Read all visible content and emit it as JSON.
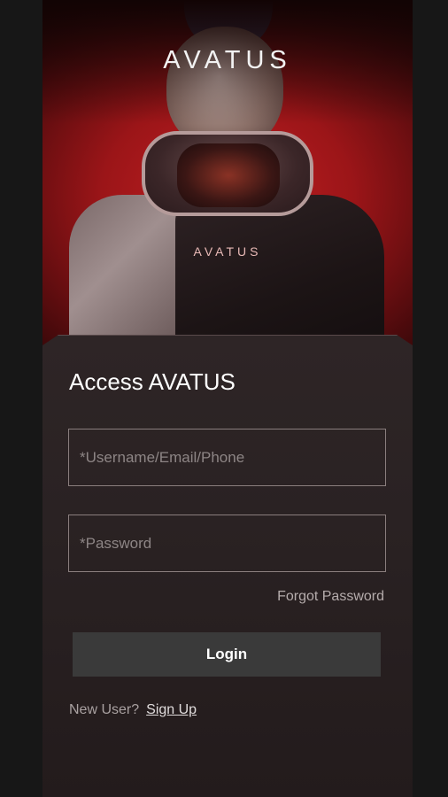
{
  "brand": {
    "logo_text": "AVATUS",
    "jacket_print": "AVATUS"
  },
  "login": {
    "title": "Access AVATUS",
    "username_placeholder": "*Username/Email/Phone",
    "password_placeholder": "*Password",
    "forgot_label": "Forgot Password",
    "login_label": "Login",
    "new_user_label": "New User?",
    "signup_label": "Sign Up"
  },
  "colors": {
    "accent_red": "#c21f22",
    "panel_bg": "#2a2223",
    "button_bg": "#3a3a3a"
  }
}
